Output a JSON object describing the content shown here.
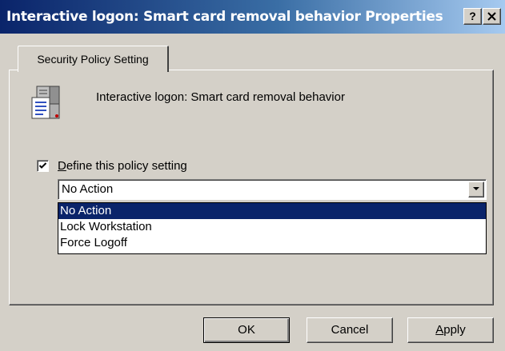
{
  "window": {
    "title": "Interactive logon: Smart card removal behavior Properties",
    "help_glyph": "?",
    "close_glyph": "✕"
  },
  "tab": {
    "label": "Security Policy Setting"
  },
  "policy": {
    "icon": "policy-server-icon",
    "name": "Interactive logon: Smart card removal behavior"
  },
  "define": {
    "checked": true,
    "label_prefix": "D",
    "label_rest": "efine this policy setting"
  },
  "combo": {
    "value": "No Action",
    "options": [
      "No Action",
      "Lock Workstation",
      "Force Logoff"
    ],
    "selected_index": 0
  },
  "buttons": {
    "ok": "OK",
    "cancel": "Cancel",
    "apply_prefix": "A",
    "apply_rest": "pply"
  },
  "colors": {
    "titlebar_start": "#0a246a",
    "titlebar_end": "#a6caf0",
    "selection": "#0a246a",
    "face": "#d4d0c8"
  }
}
